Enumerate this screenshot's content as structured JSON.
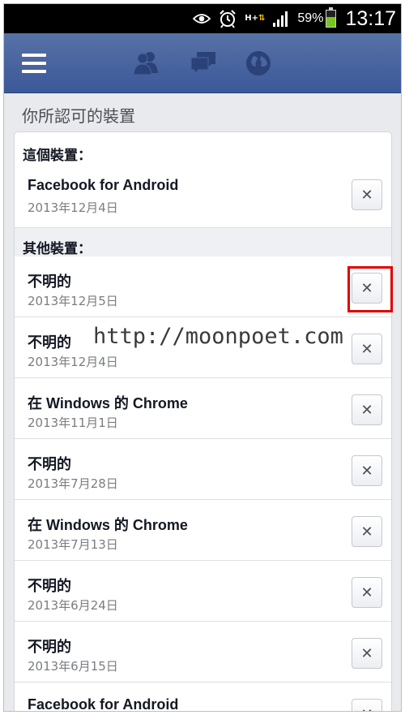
{
  "status_bar": {
    "battery_percent": "59%",
    "battery_level": 0.59,
    "time": "13:17",
    "network_type": "H+",
    "icons": [
      "eye-icon",
      "alarm-clock-icon",
      "h-plus-data-icon",
      "signal-bars-icon",
      "battery-icon"
    ]
  },
  "header": {
    "icons": [
      "menu-icon",
      "friend-requests-icon",
      "messages-icon",
      "notifications-globe-icon"
    ],
    "brand_color": "#3b5898"
  },
  "page": {
    "title": "你所認可的裝置"
  },
  "this_device": {
    "heading": "這個裝置：",
    "items": [
      {
        "name": "Facebook for Android",
        "date": "2013年12月4日"
      }
    ]
  },
  "other_devices": {
    "heading": "其他裝置：",
    "items": [
      {
        "name": "不明的",
        "date": "2013年12月5日"
      },
      {
        "name": "不明的",
        "date": "2013年12月4日"
      },
      {
        "name": "在 Windows 的 Chrome",
        "date": "2013年11月1日"
      },
      {
        "name": "不明的",
        "date": "2013年7月28日"
      },
      {
        "name": "在 Windows 的 Chrome",
        "date": "2013年7月13日"
      },
      {
        "name": "不明的",
        "date": "2013年6月24日"
      },
      {
        "name": "不明的",
        "date": "2013年6月15日"
      },
      {
        "name": "Facebook for Android",
        "date": ""
      }
    ]
  },
  "remove_button": {
    "symbol": "✕"
  },
  "watermark": "http://moonpoet.com",
  "highlight_color": "#e00000"
}
